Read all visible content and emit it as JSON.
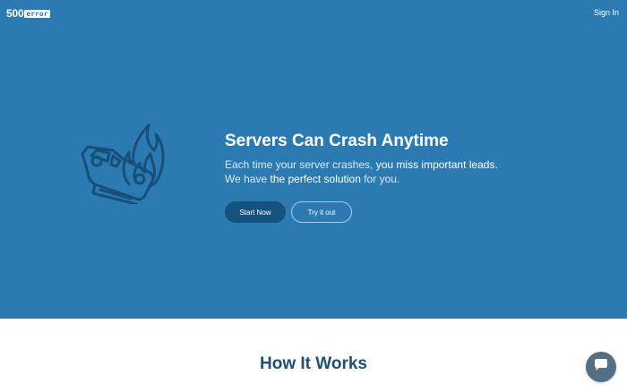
{
  "header": {
    "logo_number": "500",
    "logo_word": "error",
    "signin_label": "Sign In"
  },
  "hero": {
    "illustration_icon": "crashed-car-on-fire-icon",
    "headline": "Servers Can Crash Anytime",
    "desc_part1": "Each time your server crashes, ",
    "desc_bold1": "you miss important leads.",
    "desc_part2": "We have ",
    "desc_bold2": "the perfect solution",
    "desc_part3": " for you.",
    "primary_button": "Start Now",
    "secondary_button": "Try it out"
  },
  "section": {
    "how_title": "How It Works"
  },
  "chat": {
    "icon": "chat-bubble-icon"
  },
  "colors": {
    "hero_bg": "#2b7bb2",
    "primary_button": "#15527d",
    "heading_dark": "#1d4f7a",
    "chat_bg": "#546f84"
  }
}
